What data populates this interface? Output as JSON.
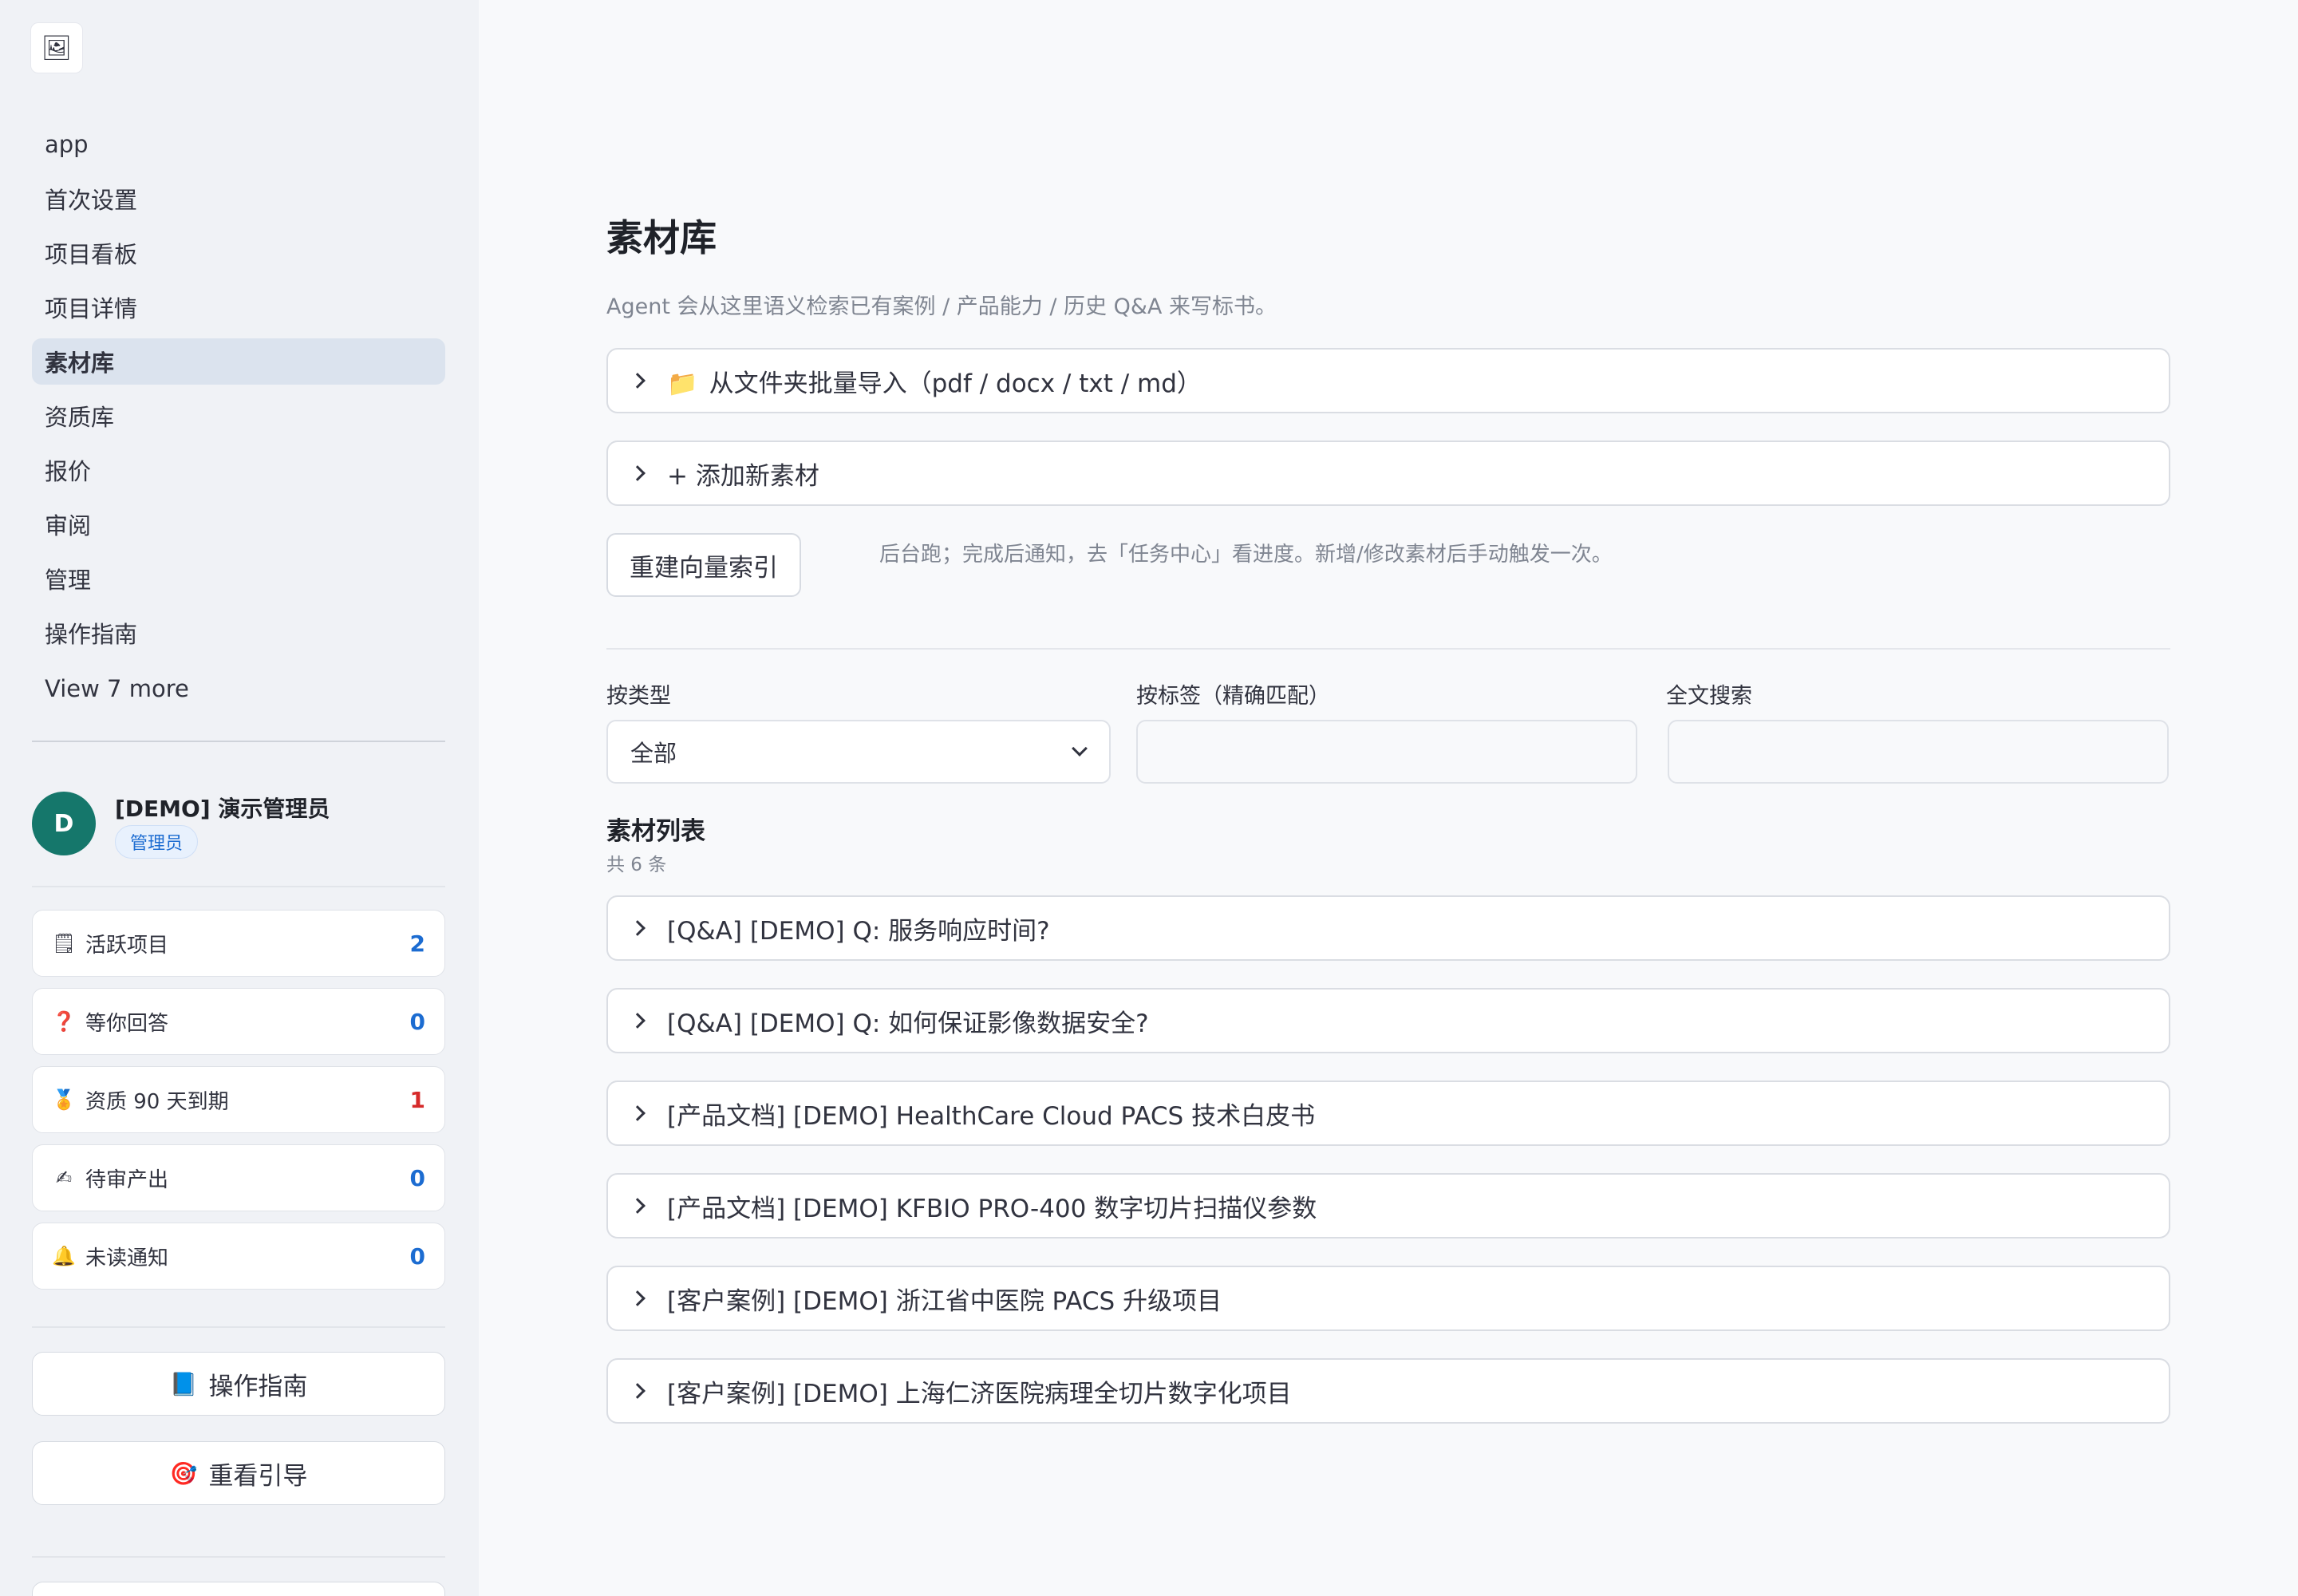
{
  "sidebar": {
    "nav": [
      {
        "label": "app",
        "active": false
      },
      {
        "label": "首次设置",
        "active": false
      },
      {
        "label": "项目看板",
        "active": false
      },
      {
        "label": "项目详情",
        "active": false
      },
      {
        "label": "素材库",
        "active": true
      },
      {
        "label": "资质库",
        "active": false
      },
      {
        "label": "报价",
        "active": false
      },
      {
        "label": "审阅",
        "active": false
      },
      {
        "label": "管理",
        "active": false
      },
      {
        "label": "操作指南",
        "active": false
      }
    ],
    "view_more": "View 7 more",
    "user": {
      "initial": "D",
      "name": "[DEMO] 演示管理员",
      "role": "管理员"
    },
    "stats": [
      {
        "icon": "🗒",
        "icon_name": "notepad-icon",
        "label": "活跃项目",
        "value": "2"
      },
      {
        "icon": "❓",
        "icon_name": "question-icon",
        "label": "等你回答",
        "value": "0"
      },
      {
        "icon": "🏅",
        "icon_name": "medal-icon",
        "label": "资质 90 天到期",
        "value": "1"
      },
      {
        "icon": "✍",
        "icon_name": "writing-hand-icon",
        "label": "待审产出",
        "value": "0"
      },
      {
        "icon": "🔔",
        "icon_name": "bell-icon",
        "label": "未读通知",
        "value": "0"
      }
    ],
    "guide_button": {
      "icon": "📘",
      "label": "操作指南"
    },
    "onboarding_button": {
      "icon": "🎯",
      "label": "重看引导"
    }
  },
  "main": {
    "title": "素材库",
    "description": "Agent 会从这里语义检索已有案例 / 产品能力 / 历史 Q&A 来写标书。",
    "import_expander": {
      "icon": "📁",
      "label": "从文件夹批量导入（pdf / docx / txt / md）"
    },
    "add_expander": {
      "label": "+ 添加新素材"
    },
    "rebuild_button": "重建向量索引",
    "rebuild_hint": "后台跑；完成后通知，去「任务中心」看进度。新增/修改素材后手动触发一次。",
    "filters": {
      "type_label": "按类型",
      "type_value": "全部",
      "tag_label": "按标签（精确匹配）",
      "tag_value": "",
      "search_label": "全文搜索",
      "search_value": ""
    },
    "list": {
      "title": "素材列表",
      "count": "共 6 条",
      "items": [
        "[Q&A] [DEMO] Q: 服务响应时间?",
        "[Q&A] [DEMO] Q: 如何保证影像数据安全?",
        "[产品文档] [DEMO] HealthCare Cloud PACS 技术白皮书",
        "[产品文档] [DEMO] KFBIO PRO-400 数字切片扫描仪参数",
        "[客户案例] [DEMO] 浙江省中医院 PACS 升级项目",
        "[客户案例] [DEMO] 上海仁济医院病理全切片数字化项目"
      ]
    }
  },
  "colors": {
    "accent": "#1c6cd1",
    "warn": "#d62a2a",
    "avatar": "#15776b",
    "active_nav": "#dbe3ee"
  }
}
